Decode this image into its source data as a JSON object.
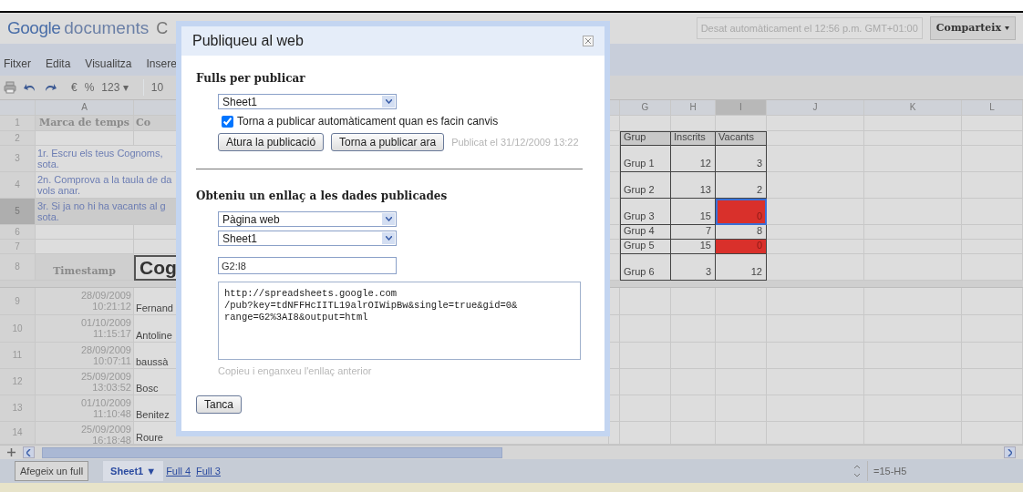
{
  "header": {
    "logo_brand": "Google",
    "logo_product": "documents",
    "doc_title": "C",
    "autosave": "Desat automàticament el 12:56 p.m. GMT+01:00",
    "share_button": "Comparteix"
  },
  "menu": [
    "Fitxer",
    "Edita",
    "Visualitza",
    "Insere"
  ],
  "toolbar": {
    "currency": "€",
    "percent": "%",
    "number_format": "123 ▾",
    "font_size": "10"
  },
  "columns": [
    {
      "label": "A",
      "selected": false
    },
    {
      "label": "G",
      "selected": false
    },
    {
      "label": "H",
      "selected": false
    },
    {
      "label": "I",
      "selected": true
    },
    {
      "label": "J",
      "selected": false
    },
    {
      "label": "K",
      "selected": false
    },
    {
      "label": "L",
      "selected": false
    }
  ],
  "rows": [
    {
      "number": "1",
      "kind": "label",
      "selected": false,
      "a": "Marca de temps",
      "b": "Co"
    },
    {
      "number": "2",
      "kind": "blank",
      "selected": false
    },
    {
      "number": "3",
      "kind": "note",
      "selected": false,
      "lines": [
        "1r. Escru els teus Cognoms,",
        "sota."
      ]
    },
    {
      "number": "4",
      "kind": "note",
      "selected": false,
      "lines": [
        "2n. Comprova a la taula de da",
        "vols anar."
      ]
    },
    {
      "number": "5",
      "kind": "note",
      "selected": true,
      "lines": [
        "3r. Si ja no hi ha vacants al g",
        "sota."
      ]
    },
    {
      "number": "6",
      "kind": "blank",
      "selected": false
    },
    {
      "number": "7",
      "kind": "blank",
      "selected": false
    },
    {
      "number": "8",
      "kind": "title",
      "selected": false,
      "a": "Timestamp",
      "b": "Cog"
    },
    {
      "number": "9",
      "kind": "entry",
      "selected": false,
      "date": "28/09/2009",
      "time": "10:21:12",
      "name": "Fernand"
    },
    {
      "number": "10",
      "kind": "entry",
      "selected": false,
      "date": "01/10/2009",
      "time": "11:15:17",
      "name": "Antoline"
    },
    {
      "number": "11",
      "kind": "entry",
      "selected": false,
      "date": "28/09/2009",
      "time": "10:07:11",
      "name": "baussà"
    },
    {
      "number": "12",
      "kind": "entry",
      "selected": false,
      "date": "25/09/2009",
      "time": "13:03:52",
      "name": "Bosc"
    },
    {
      "number": "13",
      "kind": "entry",
      "selected": false,
      "date": "01/10/2009",
      "time": "11:10:48",
      "name": "Benitez"
    },
    {
      "number": "14",
      "kind": "entry",
      "selected": false,
      "date": "25/09/2009",
      "time": "16:18:48",
      "name": "Roure"
    }
  ],
  "summary": {
    "header": [
      "Grup",
      "Inscrits",
      "Vacants"
    ],
    "rows": [
      {
        "grup": "Grup 1",
        "inscrits": "12",
        "vacants": "3",
        "alert": false,
        "selected": false
      },
      {
        "grup": "Grup 2",
        "inscrits": "13",
        "vacants": "2",
        "alert": false,
        "selected": false
      },
      {
        "grup": "Grup 3",
        "inscrits": "15",
        "vacants": "0",
        "alert": true,
        "selected": true
      },
      {
        "grup": "Grup 4",
        "inscrits": "7",
        "vacants": "8",
        "alert": false,
        "selected": false
      },
      {
        "grup": "Grup 5",
        "inscrits": "15",
        "vacants": "0",
        "alert": true,
        "selected": false
      },
      {
        "grup": "Grup 6",
        "inscrits": "3",
        "vacants": "12",
        "alert": false,
        "selected": false
      }
    ]
  },
  "sheet_bar": {
    "add_sheet": "Afegeix un full",
    "tabs": [
      {
        "label": "Sheet1 ▼",
        "selected": true
      },
      {
        "label": "Full 4",
        "selected": false
      },
      {
        "label": "Full 3",
        "selected": false
      }
    ],
    "formula": "=15-H5"
  },
  "dialog": {
    "title": "Publiqueu al web",
    "section_1": {
      "heading": "Fulls per publicar",
      "sheet": "Sheet1",
      "auto_republish": {
        "label": "Torna a publicar automàticament quan es facin canvis",
        "checked": true
      },
      "stop_button": "Atura la publicació",
      "republish_button": "Torna a publicar ara",
      "published_at": "Publicat el 31/12/2009 13:22"
    },
    "section_2": {
      "heading": "Obteniu un enllaç a les dades publicades",
      "format": "Pàgina web",
      "sheet": "Sheet1",
      "range": "G2:I8",
      "link_lines": [
        "http://spreadsheets.google.com",
        "/pub?key=tdNFFHcIITL19alrOIWipBw&single=true&gid=0&",
        "range=G2%3AI8&output=html"
      ],
      "hint": "Copieu i enganxeu l'enllaç anterior"
    },
    "close_button": "Tanca"
  }
}
